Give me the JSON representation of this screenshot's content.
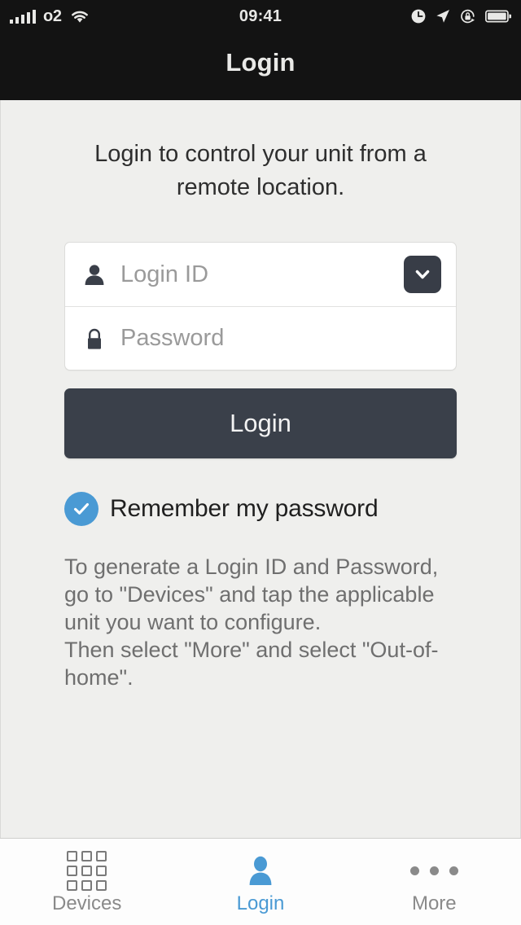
{
  "status_bar": {
    "carrier": "o2",
    "time": "09:41",
    "signal_icon": "signal-bars-icon",
    "wifi_icon": "wifi-icon",
    "alarm_icon": "alarm-clock-icon",
    "location_icon": "location-arrow-icon",
    "rotation_lock_icon": "rotation-lock-icon",
    "battery_icon": "battery-icon"
  },
  "navbar": {
    "title": "Login"
  },
  "content": {
    "intro_text": "Login to control your unit from a remote location.",
    "form": {
      "login_id": {
        "placeholder": "Login ID",
        "value": "",
        "icon": "person-icon",
        "dropdown_icon": "chevron-down-icon"
      },
      "password": {
        "placeholder": "Password",
        "value": "",
        "icon": "lock-icon"
      }
    },
    "login_button_label": "Login",
    "remember": {
      "label": "Remember my password",
      "checked": true,
      "icon": "check-circle-icon"
    },
    "help_text": "To generate a Login ID and Password, go to \"Devices\" and tap the applicable unit you want to configure.\nThen select \"More\" and select \"Out-of-home\"."
  },
  "tabbar": {
    "tabs": [
      {
        "label": "Devices",
        "icon": "grid-icon",
        "active": false
      },
      {
        "label": "Login",
        "icon": "person-icon",
        "active": true
      },
      {
        "label": "More",
        "icon": "ellipsis-icon",
        "active": false
      }
    ]
  },
  "colors": {
    "accent_blue": "#4a9ad4",
    "dark_button": "#3a404a",
    "navbar_bg": "#131313",
    "page_bg": "#efefed"
  }
}
